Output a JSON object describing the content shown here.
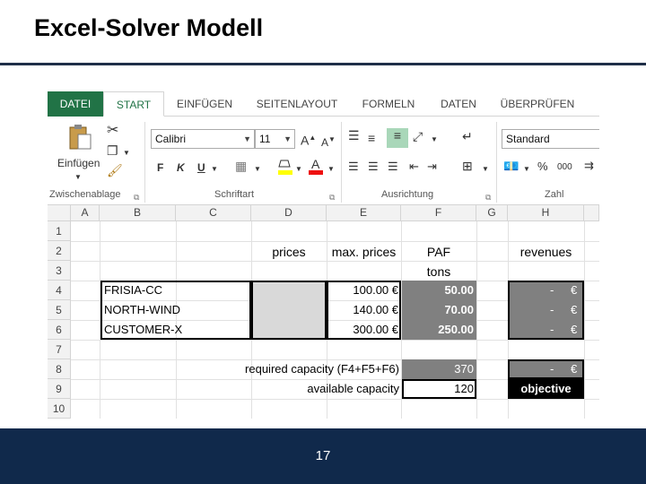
{
  "slide": {
    "title": "Excel-Solver Modell",
    "page_number": "17"
  },
  "ribbon": {
    "tabs": [
      "DATEI",
      "START",
      "EINFÜGEN",
      "SEITENLAYOUT",
      "FORMELN",
      "DATEN",
      "ÜBERPRÜFEN"
    ],
    "active_tab": "START",
    "clipboard": {
      "paste_label": "Einfügen",
      "group_label": "Zwischenablage"
    },
    "font": {
      "name": "Calibri",
      "size": "11",
      "bold": "F",
      "italic": "K",
      "underline": "U",
      "group_label": "Schriftart"
    },
    "alignment": {
      "group_label": "Ausrichtung"
    },
    "number": {
      "format": "Standard",
      "percent": "%",
      "thousands": "000",
      "group_label": "Zahl"
    }
  },
  "sheet": {
    "columns": [
      "A",
      "B",
      "C",
      "D",
      "E",
      "F",
      "G",
      "H"
    ],
    "rows": [
      "1",
      "2",
      "3",
      "4",
      "5",
      "6",
      "7",
      "8",
      "9",
      "10"
    ],
    "headers": {
      "prices": "prices",
      "max_prices": "max. prices",
      "paf": "PAF",
      "tons": "tons",
      "revenues": "revenues"
    },
    "customers": [
      {
        "name": "FRISIA-CC",
        "max_price": "100.00 €",
        "paf": "50.00",
        "revenue_dash": "-",
        "revenue_cur": "€"
      },
      {
        "name": "NORTH-WIND",
        "max_price": "140.00 €",
        "paf": "70.00",
        "revenue_dash": "-",
        "revenue_cur": "€"
      },
      {
        "name": "CUSTOMER-X",
        "max_price": "300.00 €",
        "paf": "250.00",
        "revenue_dash": "-",
        "revenue_cur": "€"
      }
    ],
    "required": {
      "label": "required capacity (F4+F5+F6)",
      "value": "370",
      "revenue_dash": "-",
      "revenue_cur": "€"
    },
    "available": {
      "label": "available capacity",
      "value": "120",
      "objective": "objective"
    }
  }
}
